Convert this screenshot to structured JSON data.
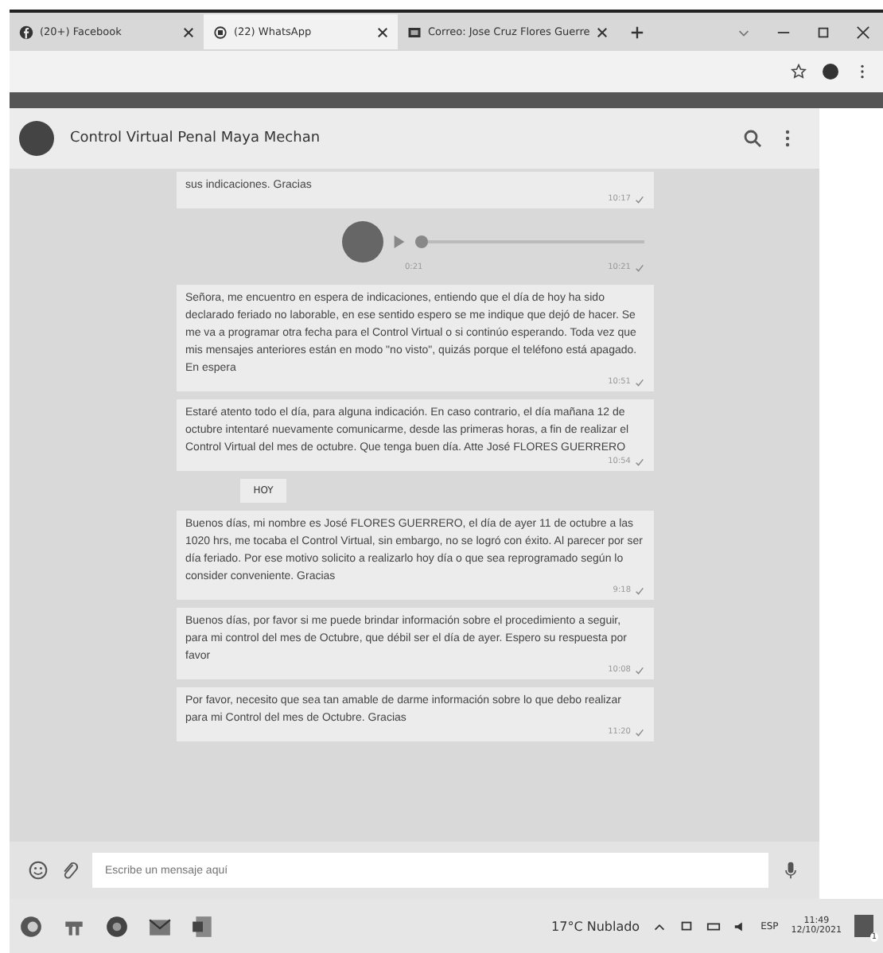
{
  "browser_tabs": [
    {
      "title": "(20+) Facebook",
      "kind": "facebook",
      "selected": false
    },
    {
      "title": "(22) WhatsApp",
      "kind": "whatsapp",
      "selected": true
    },
    {
      "title": "Correo: Jose Cruz Flores Guerre",
      "kind": "mail",
      "selected": false
    }
  ],
  "chat": {
    "title": "Control Virtual Penal Maya Mechan"
  },
  "messages": [
    {
      "kind": "text",
      "text": "sus indicaciones. Gracias",
      "time": "10:17"
    },
    {
      "kind": "audio",
      "duration": "0:21",
      "level": 0,
      "time": "10:21"
    },
    {
      "kind": "text",
      "text": "Señora, me encuentro en espera de indicaciones, entiendo que el día de hoy ha sido declarado feriado no laborable, en ese sentido espero se me indique que dejó de hacer. Se me va a programar otra fecha para el Control Virtual o si continúo esperando. Toda vez que mis mensajes anteriores están en modo \"no visto\", quizás porque el teléfono está apagado. En espera",
      "time": "10:51"
    },
    {
      "kind": "text",
      "text": "Estaré atento todo el día, para alguna indicación. En caso contrario, el día mañana 12 de octubre intentaré nuevamente comunicarme, desde las primeras horas, a fin de realizar el Control Virtual del mes de octubre. Que tenga buen día. Atte José FLORES GUERRERO",
      "time": "10:54"
    },
    {
      "kind": "date",
      "text": "HOY"
    },
    {
      "kind": "text",
      "text": "Buenos días, mi nombre es José FLORES GUERRERO, el día de ayer 11 de octubre a las 1020 hrs, me tocaba el Control Virtual, sin embargo, no se logró con éxito. Al parecer por ser día feriado. Por ese motivo solicito a realizarlo hoy día o que sea reprogramado según lo consider conveniente. Gracias",
      "time": "9:18"
    },
    {
      "kind": "text",
      "text": "Buenos días, por favor si me puede brindar información sobre el procedimiento a seguir, para mi control del mes de Octubre, que débil ser el día de ayer. Espero su respuesta por favor",
      "time": "10:08"
    },
    {
      "kind": "text",
      "text": "Por favor, necesito que sea tan amable de darme información sobre lo que debo realizar para mi Control del mes de Octubre. Gracias",
      "time": "11:20"
    }
  ],
  "composer": {
    "placeholder": "Escribe un mensaje aquí"
  },
  "taskbar": {
    "weather": "17°C Nublado",
    "language": "ESP",
    "time": "11:49",
    "date": "12/10/2021",
    "notifications": "1"
  }
}
